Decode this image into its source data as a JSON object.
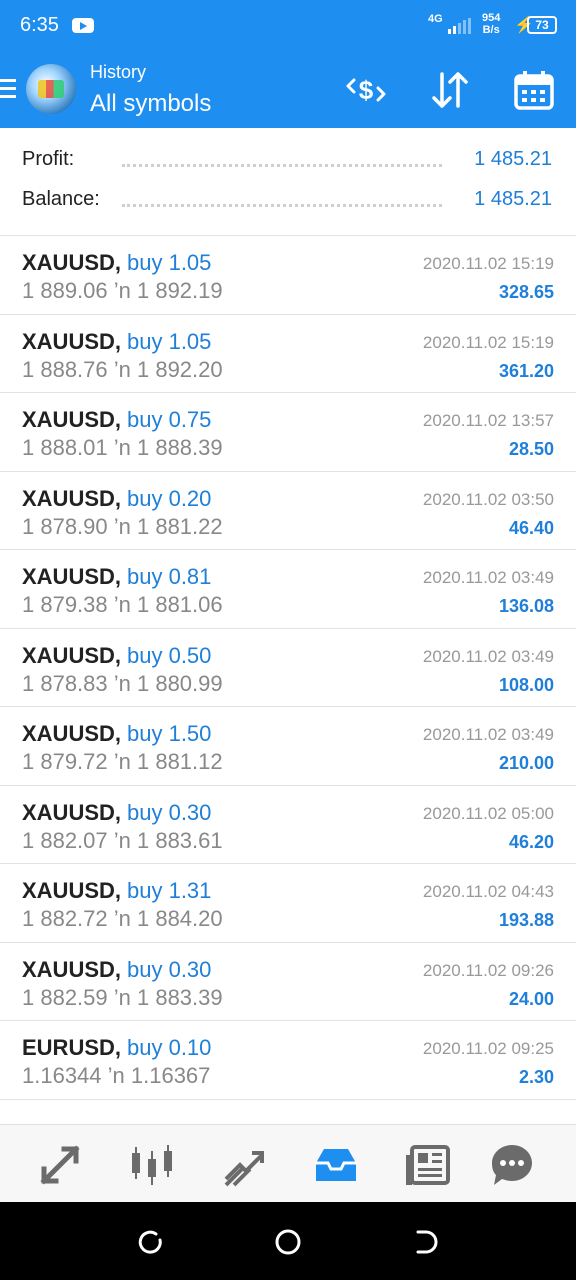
{
  "status_bar": {
    "time": "6:35",
    "network": "4G",
    "speed_value": "954",
    "speed_unit": "B/s",
    "battery": "73",
    "icons": [
      "youtube-icon",
      "signal-icon",
      "charging-icon",
      "battery-icon"
    ]
  },
  "header": {
    "subtitle": "History",
    "title": "All symbols",
    "actions": [
      "deposit-dollar-icon",
      "sort-icon",
      "calendar-icon"
    ]
  },
  "summary": {
    "profit_label": "Profit:",
    "profit_value": "1 485.21",
    "balance_label": "Balance:",
    "balance_value": "1 485.21"
  },
  "deals": [
    {
      "symbol": "XAUUSD,",
      "type": "buy 1.05",
      "prices": "1 889.06 ’n  1 892.19",
      "date": "2020.11.02 15:19",
      "profit": "328.65"
    },
    {
      "symbol": "XAUUSD,",
      "type": "buy 1.05",
      "prices": "1 888.76 ’n  1 892.20",
      "date": "2020.11.02 15:19",
      "profit": "361.20"
    },
    {
      "symbol": "XAUUSD,",
      "type": "buy 0.75",
      "prices": "1 888.01 ’n  1 888.39",
      "date": "2020.11.02 13:57",
      "profit": "28.50"
    },
    {
      "symbol": "XAUUSD,",
      "type": "buy 0.20",
      "prices": "1 878.90 ’n  1 881.22",
      "date": "2020.11.02 03:50",
      "profit": "46.40"
    },
    {
      "symbol": "XAUUSD,",
      "type": "buy 0.81",
      "prices": "1 879.38 ’n  1 881.06",
      "date": "2020.11.02 03:49",
      "profit": "136.08"
    },
    {
      "symbol": "XAUUSD,",
      "type": "buy 0.50",
      "prices": "1 878.83 ’n  1 880.99",
      "date": "2020.11.02 03:49",
      "profit": "108.00"
    },
    {
      "symbol": "XAUUSD,",
      "type": "buy 1.50",
      "prices": "1 879.72 ’n  1 881.12",
      "date": "2020.11.02 03:49",
      "profit": "210.00"
    },
    {
      "symbol": "XAUUSD,",
      "type": "buy 0.30",
      "prices": "1 882.07 ’n  1 883.61",
      "date": "2020.11.02 05:00",
      "profit": "46.20"
    },
    {
      "symbol": "XAUUSD,",
      "type": "buy 1.31",
      "prices": "1 882.72 ’n  1 884.20",
      "date": "2020.11.02 04:43",
      "profit": "193.88"
    },
    {
      "symbol": "XAUUSD,",
      "type": "buy 0.30",
      "prices": "1 882.59 ’n  1 883.39",
      "date": "2020.11.02 09:26",
      "profit": "24.00"
    },
    {
      "symbol": "EURUSD,",
      "type": "buy 0.10",
      "prices": "1.16344 ’n  1.16367",
      "date": "2020.11.02 09:25",
      "profit": "2.30"
    }
  ],
  "bottom_nav": [
    {
      "icon": "quotes-icon"
    },
    {
      "icon": "chart-icon"
    },
    {
      "icon": "trade-icon"
    },
    {
      "icon": "history-icon",
      "active": true
    },
    {
      "icon": "news-icon"
    },
    {
      "icon": "messages-icon"
    }
  ],
  "colors": {
    "accent": "#1f8ef1",
    "value_blue": "#1f7fd9",
    "text": "#222222",
    "muted": "#888888"
  }
}
